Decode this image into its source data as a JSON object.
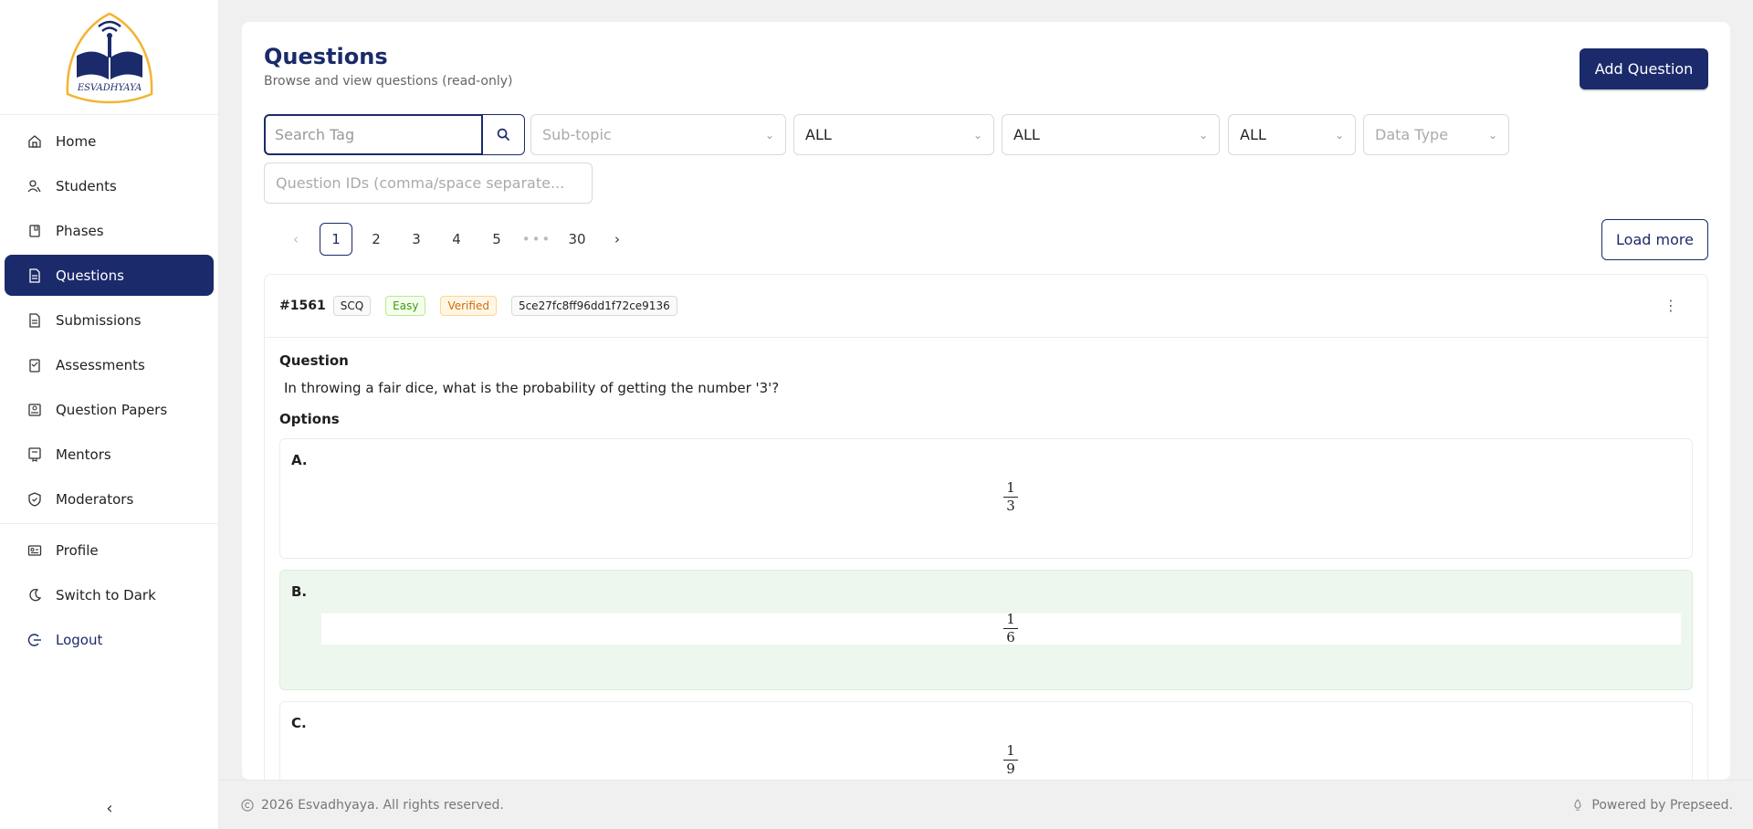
{
  "brand": {
    "logo_text": "ESVADHYAYA"
  },
  "sidebar": {
    "items": [
      {
        "label": "Home",
        "icon": "home-icon"
      },
      {
        "label": "Students",
        "icon": "users-icon"
      },
      {
        "label": "Phases",
        "icon": "book-icon"
      },
      {
        "label": "Questions",
        "icon": "file-icon",
        "active": true
      },
      {
        "label": "Submissions",
        "icon": "file-icon"
      },
      {
        "label": "Assessments",
        "icon": "clipboard-icon"
      },
      {
        "label": "Question Papers",
        "icon": "paper-icon"
      },
      {
        "label": "Mentors",
        "icon": "badge-icon"
      },
      {
        "label": "Moderators",
        "icon": "shield-icon"
      }
    ],
    "bottom_items": [
      {
        "label": "Profile",
        "icon": "id-card-icon"
      },
      {
        "label": "Switch to Dark",
        "icon": "moon-icon"
      },
      {
        "label": "Logout",
        "icon": "logout-icon"
      }
    ]
  },
  "header": {
    "title": "Questions",
    "subtitle": "Browse and view questions (read-only)",
    "add_button": "Add Question"
  },
  "filters": {
    "search_placeholder": "Search Tag",
    "subtopic_placeholder": "Sub-topic",
    "select1": "ALL",
    "select2": "ALL",
    "select3": "ALL",
    "datatype_placeholder": "Data Type",
    "ids_placeholder": "Question IDs (comma/space separate..."
  },
  "pagination": {
    "pages": [
      "1",
      "2",
      "3",
      "4",
      "5"
    ],
    "ellipsis": "•••",
    "last": "30",
    "current": 1,
    "load_more": "Load more"
  },
  "question": {
    "id": "#1561",
    "type": "SCQ",
    "difficulty": "Easy",
    "status": "Verified",
    "hash": "5ce27fc8ff96dd1f72ce9136",
    "question_label": "Question",
    "text": "In throwing a fair dice, what is the probability of getting the number '3'?",
    "options_label": "Options",
    "options": [
      {
        "letter": "A.",
        "num": "1",
        "den": "3",
        "correct": false
      },
      {
        "letter": "B.",
        "num": "1",
        "den": "6",
        "correct": true
      },
      {
        "letter": "C.",
        "num": "1",
        "den": "9",
        "correct": false
      }
    ]
  },
  "footer": {
    "copyright": "2026 Esvadhyaya. All rights reserved.",
    "powered": "Powered by Prepseed."
  },
  "colors": {
    "primary": "#1b2a6b",
    "correct_bg": "#eef7ee",
    "page_bg": "#f0f0f0"
  }
}
